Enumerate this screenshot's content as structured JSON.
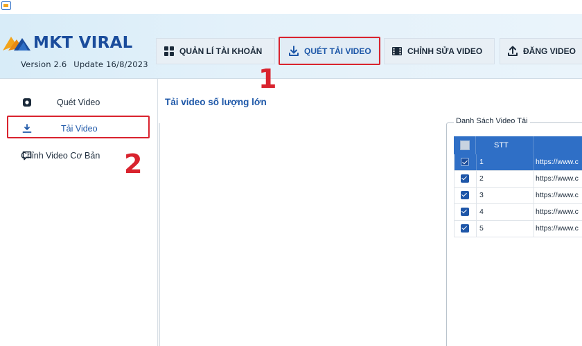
{
  "app": {
    "name": "MKT VIRAL",
    "version": "Version 2.6",
    "update": "Update 16/8/2023"
  },
  "tabs": [
    {
      "label": "QUẢN LÍ TÀI KHOẢN",
      "icon": "grid-icon"
    },
    {
      "label": "QUÉT TẢI VIDEO",
      "icon": "download-icon",
      "active": true
    },
    {
      "label": "CHỈNH SỬA VIDEO",
      "icon": "film-icon"
    },
    {
      "label": "ĐĂNG VIDEO",
      "icon": "upload-icon"
    }
  ],
  "sidebar": {
    "items": [
      {
        "label": "Quét Video",
        "icon": "camera-icon"
      },
      {
        "label": "Tải Video",
        "icon": "download-icon",
        "active": true
      },
      {
        "label": "Chỉnh Video Cơ Bản",
        "icon": "comment-icon"
      }
    ]
  },
  "main": {
    "title": "Tải video số lượng lớn",
    "group_label": "Danh Sách Video Tải",
    "table": {
      "columns": [
        "",
        "STT",
        ""
      ],
      "rows": [
        {
          "stt": "1",
          "url": "https://www.c",
          "checked": true,
          "selected": true
        },
        {
          "stt": "2",
          "url": "https://www.c",
          "checked": true
        },
        {
          "stt": "3",
          "url": "https://www.c",
          "checked": true
        },
        {
          "stt": "4",
          "url": "https://www.c",
          "checked": true
        },
        {
          "stt": "5",
          "url": "https://www.c",
          "checked": true
        }
      ]
    }
  },
  "annotations": {
    "step1": "1",
    "step2": "2"
  },
  "colors": {
    "accent": "#1d57a8",
    "header_blue": "#2f6fc6",
    "highlight_red": "#d9232e",
    "logo_orange": "#f2a41c"
  }
}
